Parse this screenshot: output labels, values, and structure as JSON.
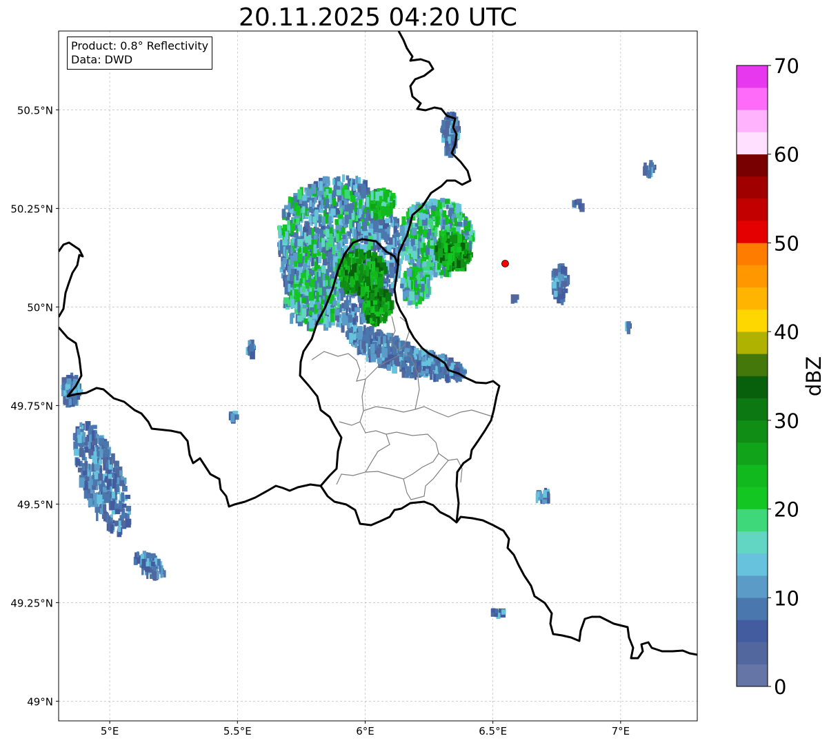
{
  "title": "20.11.2025 04:20 UTC",
  "info_box": {
    "product": "Product: 0.8° Reflectivity",
    "data": "Data: DWD"
  },
  "map": {
    "lon_range": [
      4.8,
      7.3
    ],
    "lat_range": [
      48.95,
      50.7
    ],
    "x_ticks": [
      {
        "value": 5.0,
        "label": "5°E"
      },
      {
        "value": 5.5,
        "label": "5.5°E"
      },
      {
        "value": 6.0,
        "label": "6°E"
      },
      {
        "value": 6.5,
        "label": "6.5°E"
      },
      {
        "value": 7.0,
        "label": "7°E"
      }
    ],
    "y_ticks": [
      {
        "value": 49.0,
        "label": "49°N"
      },
      {
        "value": 49.25,
        "label": "49.25°N"
      },
      {
        "value": 49.5,
        "label": "49.5°N"
      },
      {
        "value": 49.75,
        "label": "49.75°N"
      },
      {
        "value": 50.0,
        "label": "50°N"
      },
      {
        "value": 50.25,
        "label": "50.25°N"
      },
      {
        "value": 50.5,
        "label": "50.5°N"
      }
    ],
    "grid": true,
    "radar_site": {
      "lon": 6.548,
      "lat": 50.11,
      "color": "#ff0000"
    }
  },
  "colorbar": {
    "label": "dBZ",
    "min": 0,
    "max": 70,
    "step": 2.5,
    "tick_values": [
      0,
      10,
      20,
      30,
      40,
      50,
      60,
      70
    ],
    "tick_labels": [
      "0",
      "10",
      "20",
      "30",
      "40",
      "50",
      "60",
      "70"
    ],
    "colors": [
      "#6575a5",
      "#51679d",
      "#425c9f",
      "#4a77ae",
      "#5a9cc7",
      "#66c2dd",
      "#62d6c3",
      "#3ed77a",
      "#13c622",
      "#12b91e",
      "#11a31a",
      "#0f8d15",
      "#0c7812",
      "#08600d",
      "#45780b",
      "#afb200",
      "#fed700",
      "#feb400",
      "#fe9700",
      "#fe7d00",
      "#e50000",
      "#c20000",
      "#a00000",
      "#780000",
      "#ffe0fe",
      "#ffb3fd",
      "#ff6bf9",
      "#e737ef"
    ]
  }
}
